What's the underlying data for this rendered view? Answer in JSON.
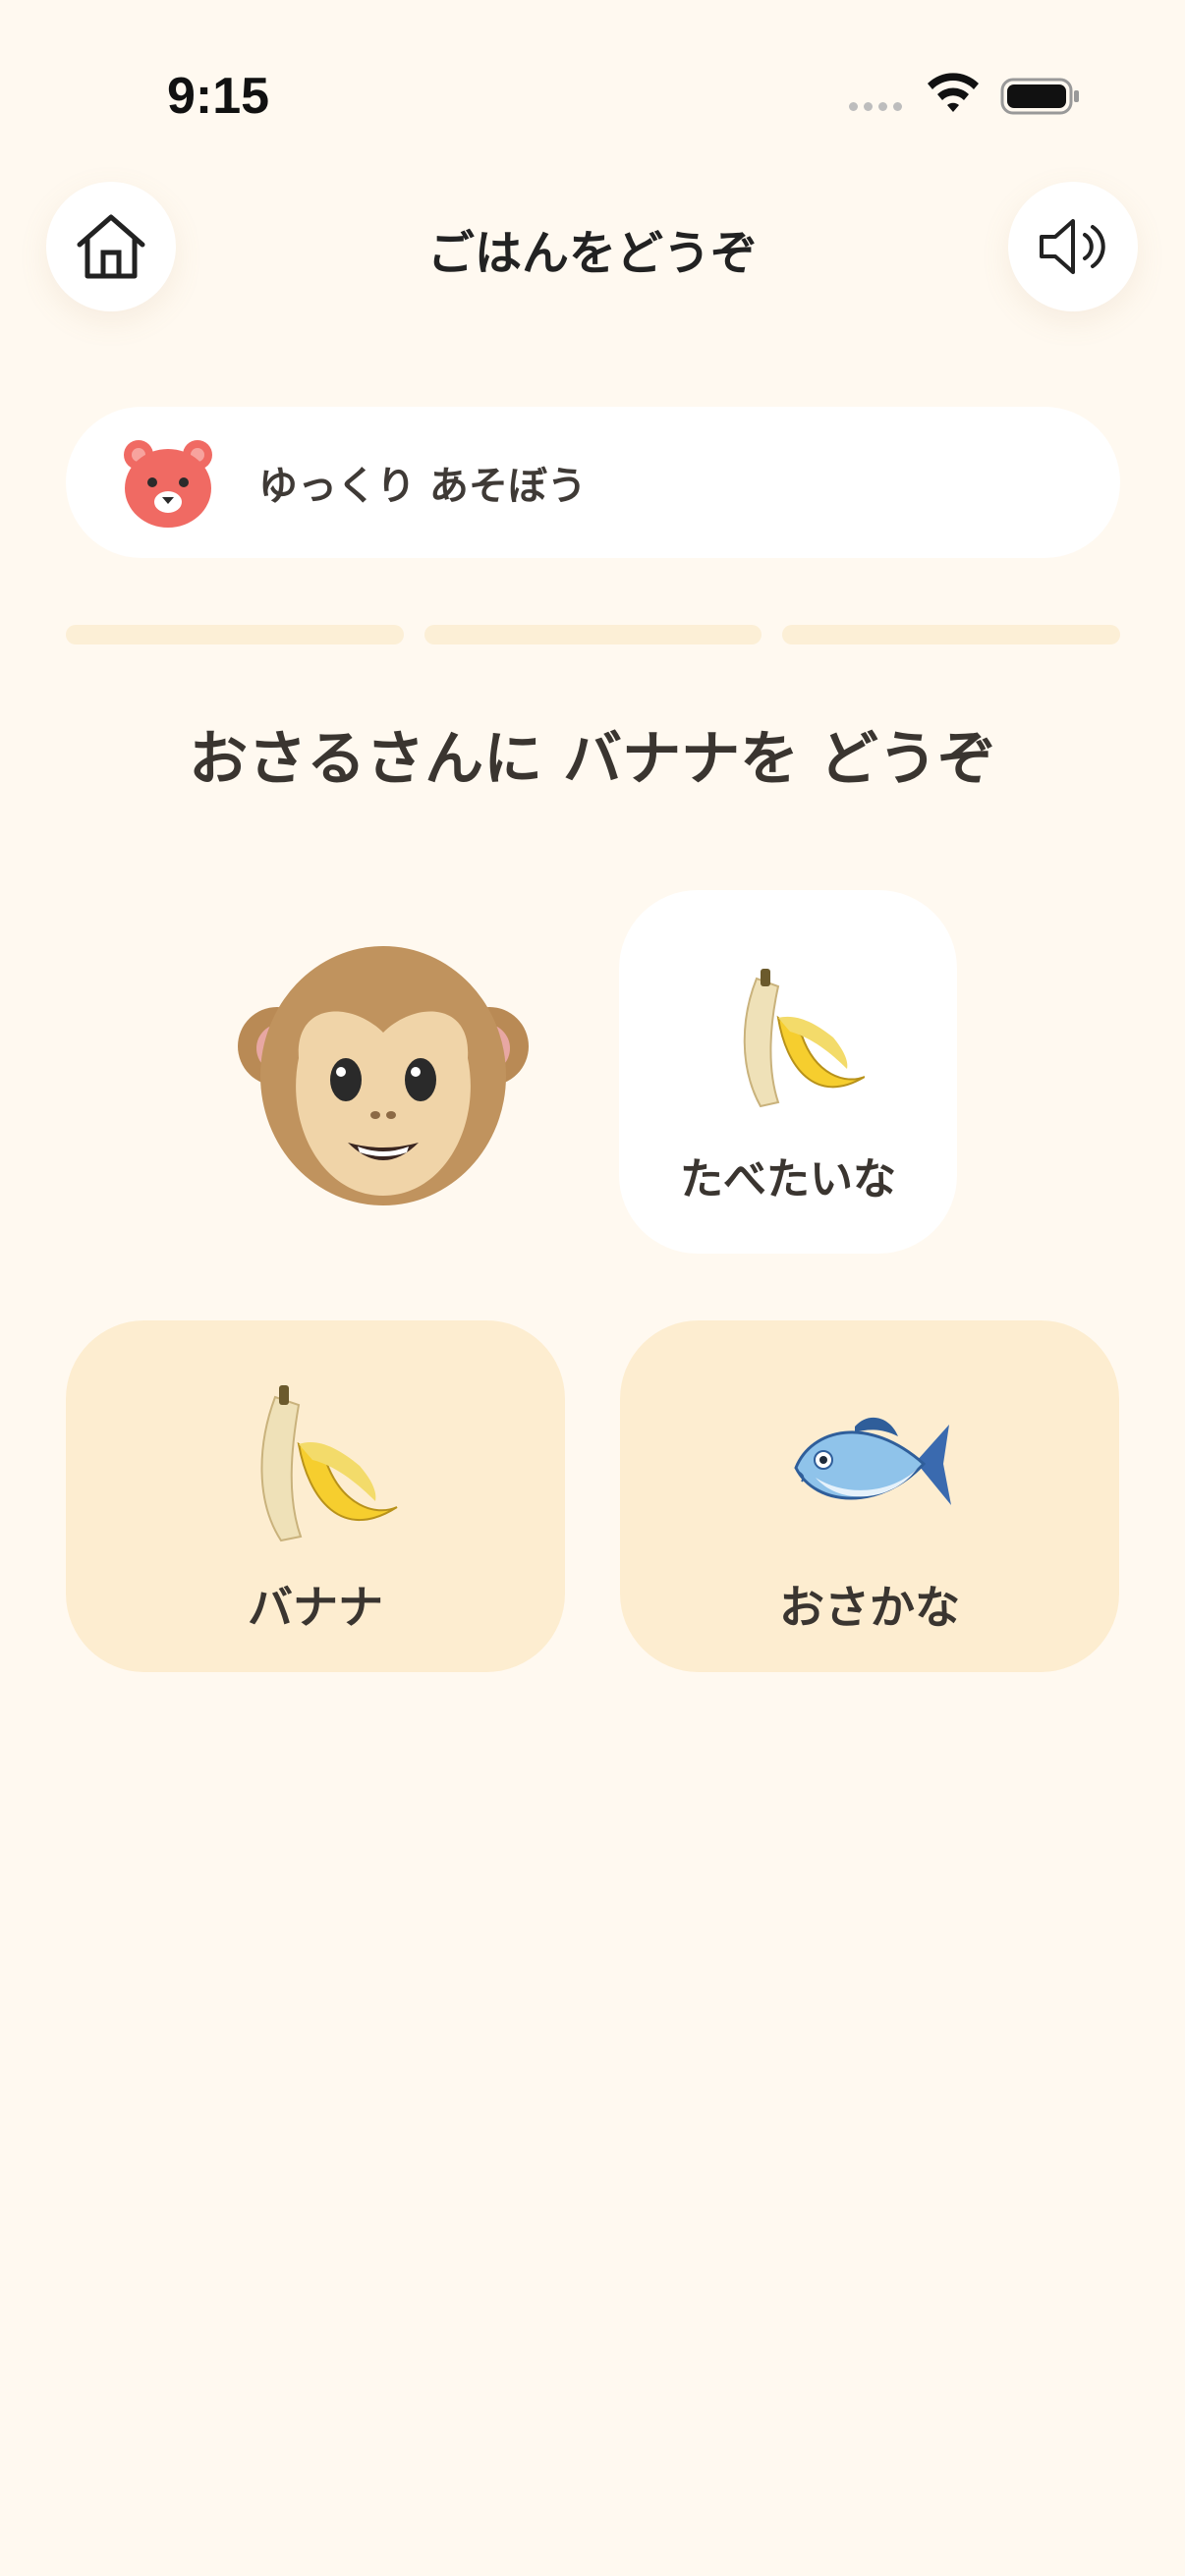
{
  "status": {
    "time": "9:15"
  },
  "header": {
    "title": "ごはんをどうぞ",
    "home_icon": "home-icon",
    "sound_icon": "speaker-icon"
  },
  "mode": {
    "label": "ゆっくり あそぼう",
    "icon": "bear-face-icon",
    "icon_color": "#F06A63"
  },
  "progress": {
    "current": 0,
    "total": 3
  },
  "question": "おさるさんに バナナを どうぞ",
  "speech": {
    "label": "たべたいな",
    "icon": "banana-icon"
  },
  "choices": [
    {
      "label": "バナナ",
      "icon": "banana-icon"
    },
    {
      "label": "おさかな",
      "icon": "fish-icon"
    }
  ],
  "colors": {
    "background": "#FFF9F0",
    "card": "#FFFFFF",
    "choice": "#FDEDD0",
    "progress": "#FCEFD6",
    "text": "#3A3530"
  }
}
